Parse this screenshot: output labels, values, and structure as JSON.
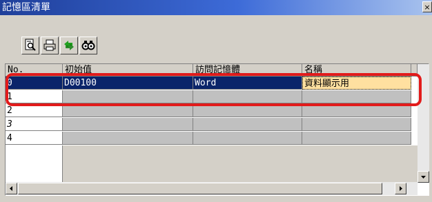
{
  "window": {
    "title": "記憶區清單",
    "close_glyph": "×"
  },
  "toolbar": {
    "buttons": [
      {
        "icon": "preview-icon"
      },
      {
        "icon": "print-icon"
      },
      {
        "icon": "refresh-arrows-icon"
      },
      {
        "icon": "binoculars-icon"
      }
    ]
  },
  "grid": {
    "columns": [
      "No.",
      "初始值",
      "訪問記憶體",
      "名稱"
    ],
    "rows": [
      {
        "no": "0",
        "initial": "D00100",
        "access": "Word",
        "name": "資料顯示用",
        "selected": true
      },
      {
        "no": "1",
        "initial": "",
        "access": "",
        "name": ""
      },
      {
        "no": "2",
        "initial": "",
        "access": "",
        "name": ""
      },
      {
        "no": "3",
        "initial": "",
        "access": "",
        "name": ""
      },
      {
        "no": "4",
        "initial": "",
        "access": "",
        "name": ""
      }
    ]
  },
  "colors": {
    "selection": "#0a246a",
    "highlight": "#e21b1b",
    "name_cell": "#ffe0a0"
  }
}
